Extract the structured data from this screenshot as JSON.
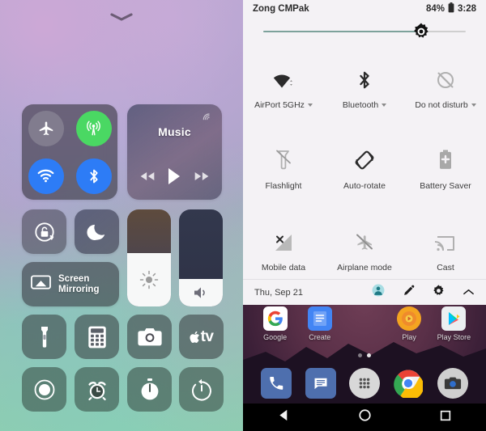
{
  "ios_control_center": {
    "grabber_icon": "chevron-down-icon",
    "connectivity": {
      "airplane_mode": {
        "label": "Airplane Mode",
        "icon": "airplane-icon",
        "state": "off",
        "color": "#8a8896"
      },
      "cellular_data": {
        "label": "Cellular Data",
        "icon": "cellular-antenna-icon",
        "state": "on",
        "color": "#4ad863"
      },
      "wifi": {
        "label": "Wi-Fi",
        "icon": "wifi-icon",
        "state": "on",
        "color": "#2d7cf6"
      },
      "bluetooth": {
        "label": "Bluetooth",
        "icon": "bluetooth-icon",
        "state": "on",
        "color": "#2d7cf6"
      }
    },
    "music": {
      "title": "Music",
      "airplay_icon": "airplay-audio-icon",
      "previous_icon": "rewind-icon",
      "play_icon": "play-icon",
      "next_icon": "fast-forward-icon"
    },
    "rotation_lock": {
      "icon": "rotation-lock-icon",
      "state": "off"
    },
    "do_not_disturb": {
      "icon": "moon-icon",
      "state": "off"
    },
    "screen_mirroring": {
      "label_line1": "Screen",
      "label_line2": "Mirroring",
      "icon": "screen-mirroring-icon"
    },
    "brightness_slider": {
      "icon": "brightness-sun-icon",
      "value_percent": 55
    },
    "volume_slider": {
      "icon": "speaker-volume-icon",
      "value_percent": 28
    },
    "shortcuts_row1": [
      {
        "name": "Flashlight",
        "icon": "flashlight-icon"
      },
      {
        "name": "Calculator",
        "icon": "calculator-icon"
      },
      {
        "name": "Camera",
        "icon": "camera-icon"
      },
      {
        "name": "Apple TV Remote",
        "icon": "apple-tv-icon",
        "text": "tv"
      }
    ],
    "shortcuts_row2": [
      {
        "name": "Screen Recording",
        "icon": "record-icon"
      },
      {
        "name": "Alarm",
        "icon": "alarm-clock-icon"
      },
      {
        "name": "Stopwatch",
        "icon": "stopwatch-icon"
      },
      {
        "name": "Timer",
        "icon": "timer-icon"
      }
    ]
  },
  "android_quick_settings": {
    "status_bar": {
      "carrier": "Zong CMPak",
      "battery_percent": "84%",
      "battery_icon": "battery-icon",
      "time": "3:28"
    },
    "brightness": {
      "icon": "brightness-sun-icon",
      "value_percent": 78
    },
    "tiles": [
      {
        "label": "AirPort 5GHz",
        "icon": "wifi-icon",
        "has_caret": true,
        "state": "on"
      },
      {
        "label": "Bluetooth",
        "icon": "bluetooth-icon",
        "has_caret": true,
        "state": "on"
      },
      {
        "label": "Do not disturb",
        "icon": "do-not-disturb-icon",
        "has_caret": true,
        "state": "off"
      },
      {
        "label": "Flashlight",
        "icon": "flashlight-off-icon",
        "has_caret": false,
        "state": "off"
      },
      {
        "label": "Auto-rotate",
        "icon": "auto-rotate-icon",
        "has_caret": false,
        "state": "on"
      },
      {
        "label": "Battery Saver",
        "icon": "battery-saver-icon",
        "has_caret": false,
        "state": "off"
      },
      {
        "label": "Mobile data",
        "icon": "mobile-data-off-icon",
        "has_caret": false,
        "state": "off"
      },
      {
        "label": "Airplane mode",
        "icon": "airplane-off-icon",
        "has_caret": false,
        "state": "off"
      },
      {
        "label": "Cast",
        "icon": "cast-icon",
        "has_caret": false,
        "state": "off"
      }
    ],
    "footer": {
      "date": "Thu, Sep 21",
      "user_icon": "user-avatar-icon",
      "edit_icon": "pencil-icon",
      "settings_icon": "gear-icon",
      "collapse_icon": "chevron-up-icon",
      "accent_color": "#4db6c4"
    }
  },
  "android_home": {
    "apps": [
      {
        "name": "Google",
        "icon": "google-g-icon"
      },
      {
        "name": "Create",
        "icon": "docs-icon"
      },
      {
        "name": "Play",
        "icon": "play-music-icon"
      },
      {
        "name": "Play Store",
        "icon": "play-store-icon"
      }
    ],
    "page_dots": {
      "count": 2,
      "active_index": 1
    },
    "dock": [
      {
        "name": "Phone",
        "icon": "phone-icon"
      },
      {
        "name": "Messages",
        "icon": "message-icon"
      },
      {
        "name": "All Apps",
        "icon": "app-drawer-icon"
      },
      {
        "name": "Chrome",
        "icon": "chrome-icon"
      },
      {
        "name": "Camera",
        "icon": "camera-icon"
      }
    ],
    "navbar": [
      {
        "name": "Back",
        "icon": "back-triangle-icon"
      },
      {
        "name": "Home",
        "icon": "home-circle-icon"
      },
      {
        "name": "Recents",
        "icon": "recents-square-icon"
      }
    ]
  }
}
